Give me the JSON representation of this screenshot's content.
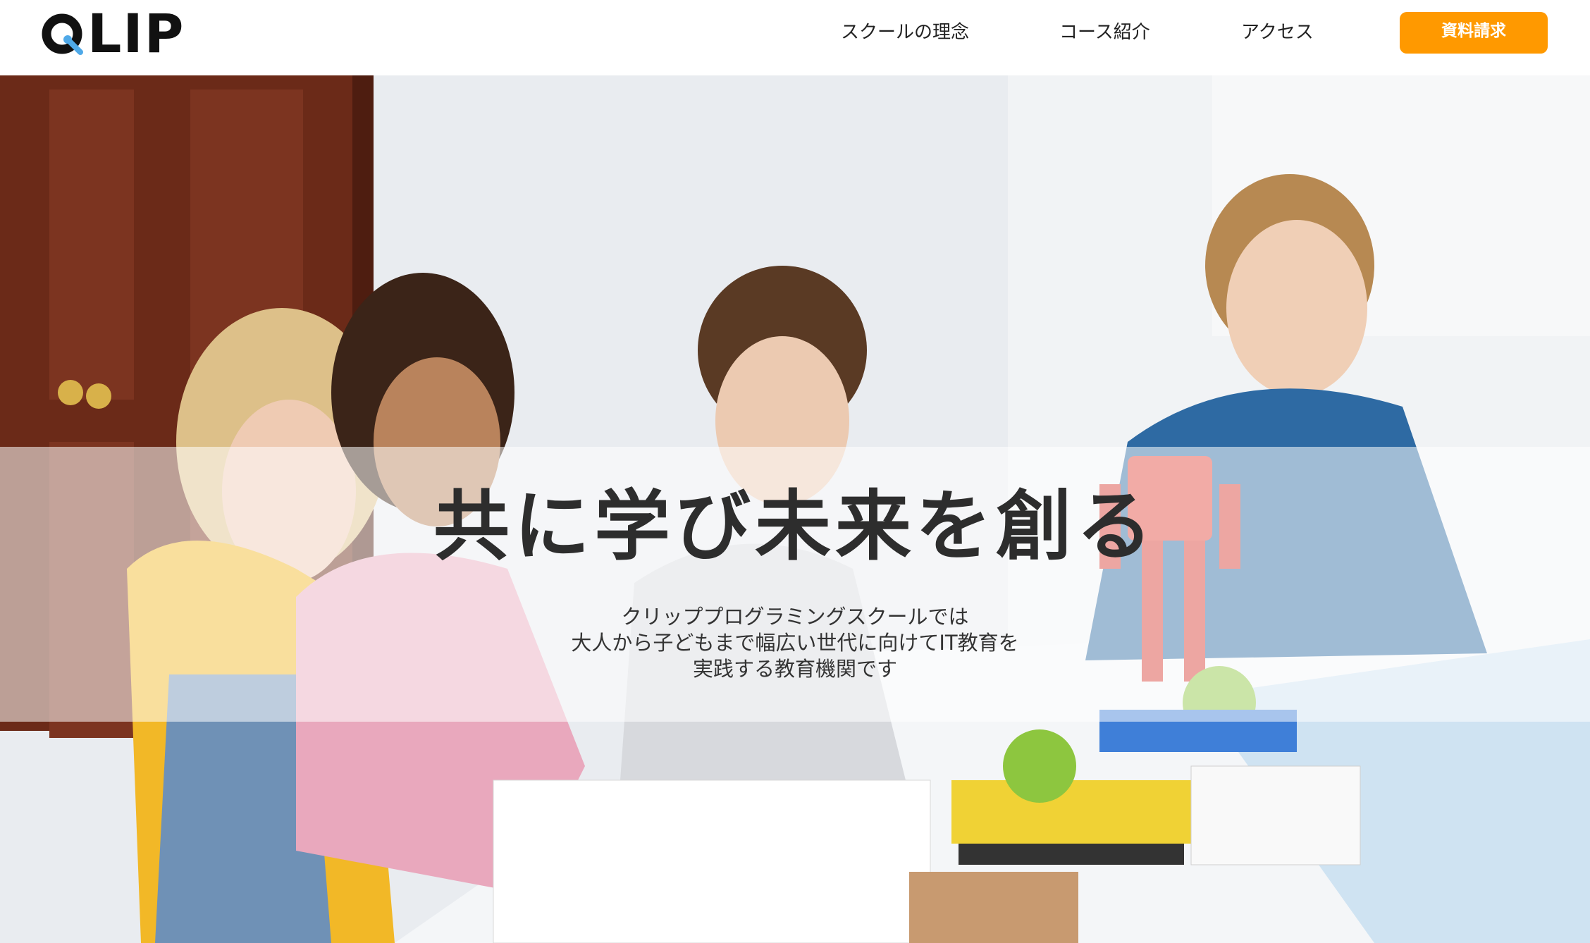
{
  "header": {
    "logo": {
      "text": "LIP",
      "alt": "QLIP",
      "colors": {
        "mark": "#111111",
        "accent": "#4fa9e8"
      }
    },
    "nav": [
      {
        "label": "スクールの理念"
      },
      {
        "label": "コース紹介"
      },
      {
        "label": "アクセス"
      }
    ],
    "cta": {
      "label": "資料請求",
      "color": "#ff9900"
    }
  },
  "hero": {
    "title": "共に学び未来を創る",
    "subtitle": [
      "クリッププログラミングスクールでは",
      "大人から子どもまで幅広い世代に向けてIT教育を",
      "実践する教育機関です"
    ]
  }
}
